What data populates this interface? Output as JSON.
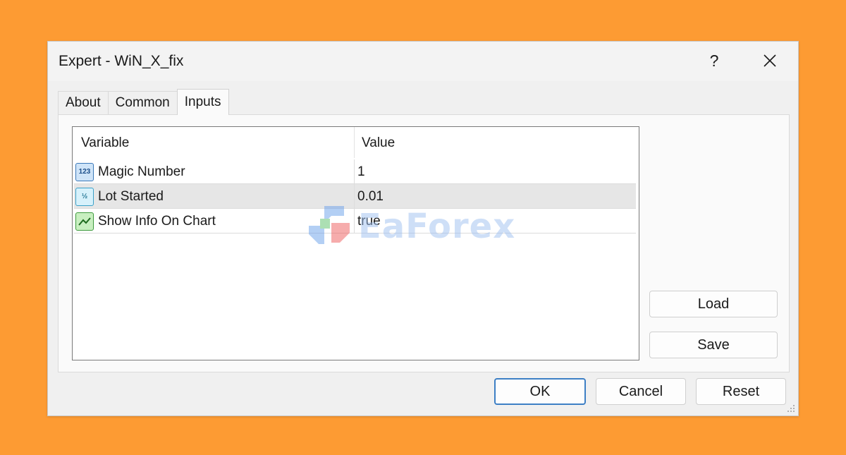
{
  "window": {
    "title": "Expert - WiN_X_fix",
    "help_label": "?"
  },
  "tabs": [
    {
      "label": "About"
    },
    {
      "label": "Common"
    },
    {
      "label": "Inputs"
    }
  ],
  "active_tab": "Inputs",
  "inputs_table": {
    "columns": {
      "variable": "Variable",
      "value": "Value"
    },
    "rows": [
      {
        "icon": "integer-type-icon",
        "icon_text": "123",
        "variable": "Magic Number",
        "value": "1"
      },
      {
        "icon": "double-type-icon",
        "icon_text": "½",
        "variable": "Lot Started",
        "value": "0.01"
      },
      {
        "icon": "boolean-type-icon",
        "icon_text": "",
        "variable": "Show Info On Chart",
        "value": "true"
      }
    ],
    "selected_row": 1
  },
  "side_buttons": {
    "load": "Load",
    "save": "Save"
  },
  "footer_buttons": {
    "ok": "OK",
    "cancel": "Cancel",
    "reset": "Reset"
  },
  "watermark": {
    "text": "EaForex"
  },
  "colors": {
    "background": "#fd9b33",
    "dialog": "#f0f0f0",
    "default_button_border": "#3d7fc5",
    "selected_row": "#e6e6e6"
  }
}
